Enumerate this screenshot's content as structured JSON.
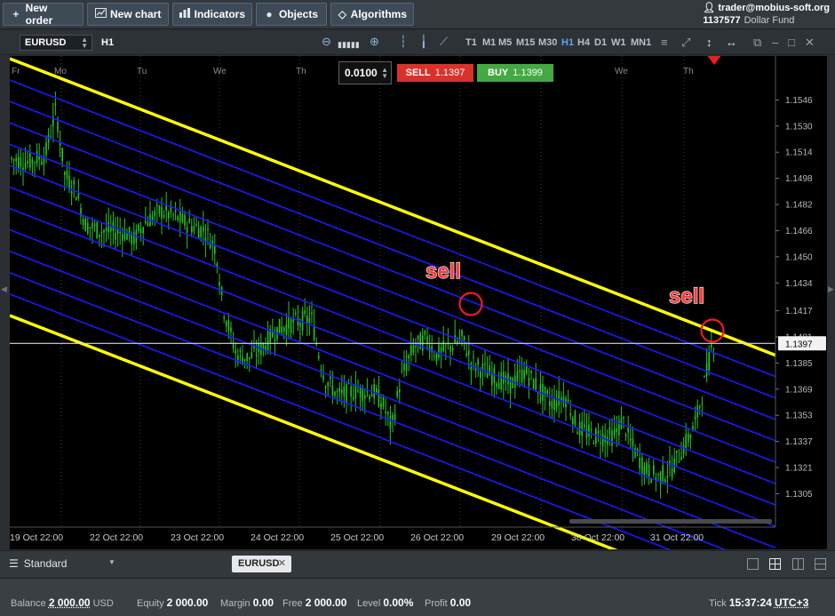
{
  "toolbar": {
    "new_order": "New order",
    "new_chart": "New chart",
    "indicators": "Indicators",
    "objects": "Objects",
    "algorithms": "Algorithms"
  },
  "user": {
    "email": "trader@mobius-soft.org",
    "account": "1137577",
    "fund": "Dollar Fund"
  },
  "chart_header": {
    "symbol": "EURUSD",
    "timeframe": "H1",
    "timeframes": [
      "T1",
      "M1",
      "M5",
      "M15",
      "M30",
      "H1",
      "H4",
      "D1",
      "W1",
      "MN1"
    ],
    "active_timeframe": "H1"
  },
  "order": {
    "lot": "0.0100",
    "sell_label": "SELL",
    "sell_price": "1.1397",
    "buy_label": "BUY",
    "buy_price": "1.1399"
  },
  "chart_data": {
    "type": "candlestick",
    "symbol": "EURUSD",
    "timeframe": "H1",
    "ylim": [
      1.129,
      1.1562
    ],
    "y_ticks": [
      "1.1546",
      "1.1530",
      "1.1514",
      "1.1498",
      "1.1482",
      "1.1466",
      "1.1450",
      "1.1434",
      "1.1417",
      "1.1401",
      "1.1385",
      "1.1369",
      "1.1353",
      "1.1337",
      "1.1321",
      "1.1305"
    ],
    "x_ticks": [
      "19 Oct 22:00",
      "22 Oct 22:00",
      "23 Oct 22:00",
      "24 Oct 22:00",
      "25 Oct 22:00",
      "26 Oct 22:00",
      "29 Oct 22:00",
      "30 Oct 22:00",
      "31 Oct 22:00"
    ],
    "day_labels": [
      "Fr",
      "Mo",
      "Tu",
      "We",
      "Th",
      "We",
      "Th"
    ],
    "current_price": "1.1397",
    "annotations": [
      "sell",
      "sell"
    ],
    "colors": {
      "candles": "#28c428",
      "channel_outer": "#ffff00",
      "channel_inner": "#1a1aff",
      "price_line": "#d8d8d8",
      "marker": "#e81d25"
    }
  },
  "tabs": {
    "workspace": "Standard",
    "chart_tab": "EURUSD"
  },
  "status": {
    "balance_label": "Balance",
    "balance_value": "2 000.00",
    "balance_currency": "USD",
    "equity_label": "Equity",
    "equity_value": "2 000.00",
    "margin_label": "Margin",
    "margin_value": "0.00",
    "free_label": "Free",
    "free_value": "2 000.00",
    "level_label": "Level",
    "level_value": "0.00%",
    "profit_label": "Profit",
    "profit_value": "0.00",
    "tick_label": "Tick",
    "tick_time": "15:37:24",
    "timezone": "UTC+3"
  }
}
